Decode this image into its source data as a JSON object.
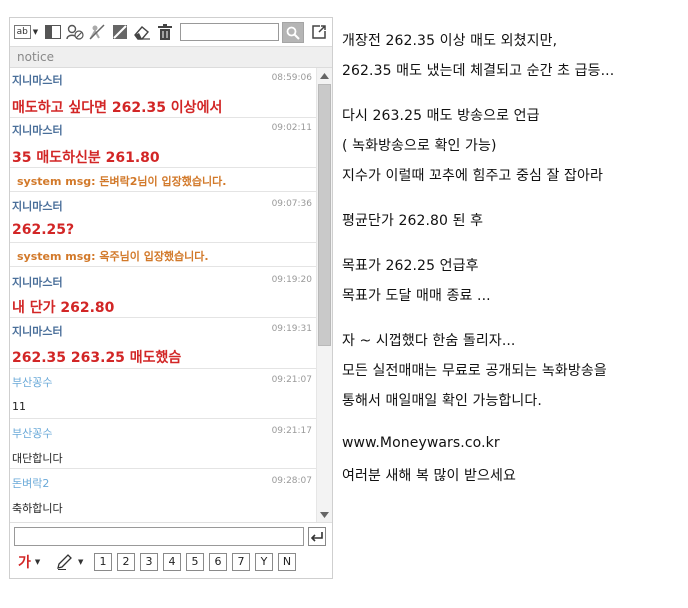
{
  "chat": {
    "toolbar": {
      "ab_label": "ab",
      "icons": [
        "text-style-icon",
        "layout-icon",
        "users-icon",
        "block-icon",
        "edit-slash-icon",
        "eraser-icon",
        "trash-icon",
        "search-icon",
        "popout-icon"
      ],
      "search_value": ""
    },
    "notice_label": "notice",
    "messages": [
      {
        "type": "user",
        "name": "지니마스터",
        "time": "08:59:06",
        "text": "매도하고 싶다면 262.35 이상에서"
      },
      {
        "type": "user",
        "name": "지니마스터",
        "time": "09:02:11",
        "text": "35 매도하신분 261.80"
      },
      {
        "type": "system",
        "text": "system msg: 돈벼락2님이 입장했습니다."
      },
      {
        "type": "user",
        "name": "지니마스터",
        "time": "09:07:36",
        "text": "262.25?"
      },
      {
        "type": "system",
        "text": "system msg: 옥주님이 입장했습니다."
      },
      {
        "type": "user",
        "name": "지니마스터",
        "time": "09:19:20",
        "text": "내 단가 262.80"
      },
      {
        "type": "user",
        "name": "지니마스터",
        "time": "09:19:31",
        "text": "262.35 263.25 매도했슴"
      },
      {
        "type": "guest",
        "name": "부산꽁수",
        "time": "09:21:07",
        "text": "11"
      },
      {
        "type": "guest",
        "name": "부산꽁수",
        "time": "09:21:17",
        "text": "대단합니다"
      },
      {
        "type": "guest",
        "name": "돈벼락2",
        "time": "09:28:07",
        "text": "축하합니다"
      }
    ],
    "input": {
      "value": "",
      "placeholder": ""
    },
    "font_button_label": "가",
    "number_buttons": [
      "1",
      "2",
      "3",
      "4",
      "5",
      "6",
      "7",
      "Y",
      "N"
    ]
  },
  "notes": [
    "개장전 262.35 이상 매도 외쳤지만,",
    "262.35 매도 냈는데 체결되고 순간 초 급등...",
    "다시 263.25 매도 방송으로 언급",
    "( 녹화방송으로 확인 가능)",
    "지수가 이럴때 꼬추에 힘주고 중심 잘 잡아라",
    "평균단가 262.80 된 후",
    "목표가 262.25 언급후",
    "목표가 도달 매매 종료 ...",
    "자 ~ 시껍했다 한숨 돌리자...",
    "모든 실전매매는 무료로 공개되는 녹화방송을",
    "통해서 매일매일 확인 가능합니다.",
    "www.Moneywars.co.kr",
    "여러분 새해 복 많이 받으세요"
  ],
  "colors": {
    "master_name": "#4a6f9a",
    "guest_name": "#6aa9d8",
    "message_red": "#d22626",
    "system_orange": "#d2792a",
    "timestamp": "#9a9a9a"
  }
}
